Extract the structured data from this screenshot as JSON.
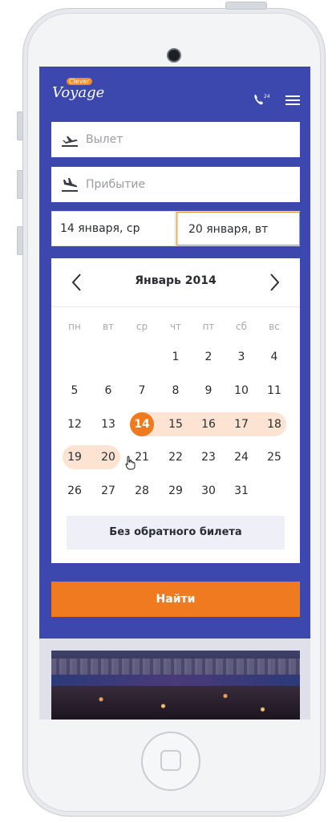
{
  "header": {
    "logo_text": "Voyage",
    "logo_badge": "Clever",
    "phone_badge": "24"
  },
  "search": {
    "departure_placeholder": "Вылет",
    "arrival_placeholder": "Прибытие",
    "date_from": "14 января, ср",
    "date_to": "20 января, вт"
  },
  "calendar": {
    "month_title": "Январь 2014",
    "weekdays": [
      "пн",
      "вт",
      "ср",
      "чт",
      "пт",
      "сб",
      "вс"
    ],
    "weeks": [
      [
        "",
        "",
        "",
        "1",
        "2",
        "3",
        "4"
      ],
      [
        "5",
        "6",
        "7",
        "8",
        "9",
        "10",
        "11"
      ],
      [
        "12",
        "13",
        "14",
        "15",
        "16",
        "17",
        "18"
      ],
      [
        "19",
        "20",
        "21",
        "22",
        "23",
        "24",
        "25"
      ],
      [
        "26",
        "27",
        "28",
        "29",
        "30",
        "31",
        ""
      ]
    ],
    "selected_start": "14",
    "selected_end": "20",
    "no_return_label": "Без обратного билета"
  },
  "actions": {
    "search_label": "Найти"
  },
  "colors": {
    "brand": "#3c48ae",
    "accent": "#f07a1f",
    "range": "#fde3d1"
  },
  "icons": [
    "departure-plane-icon",
    "arrival-plane-icon",
    "phone-24-icon",
    "menu-icon",
    "chevron-left-icon",
    "chevron-right-icon",
    "hand-cursor-icon"
  ]
}
